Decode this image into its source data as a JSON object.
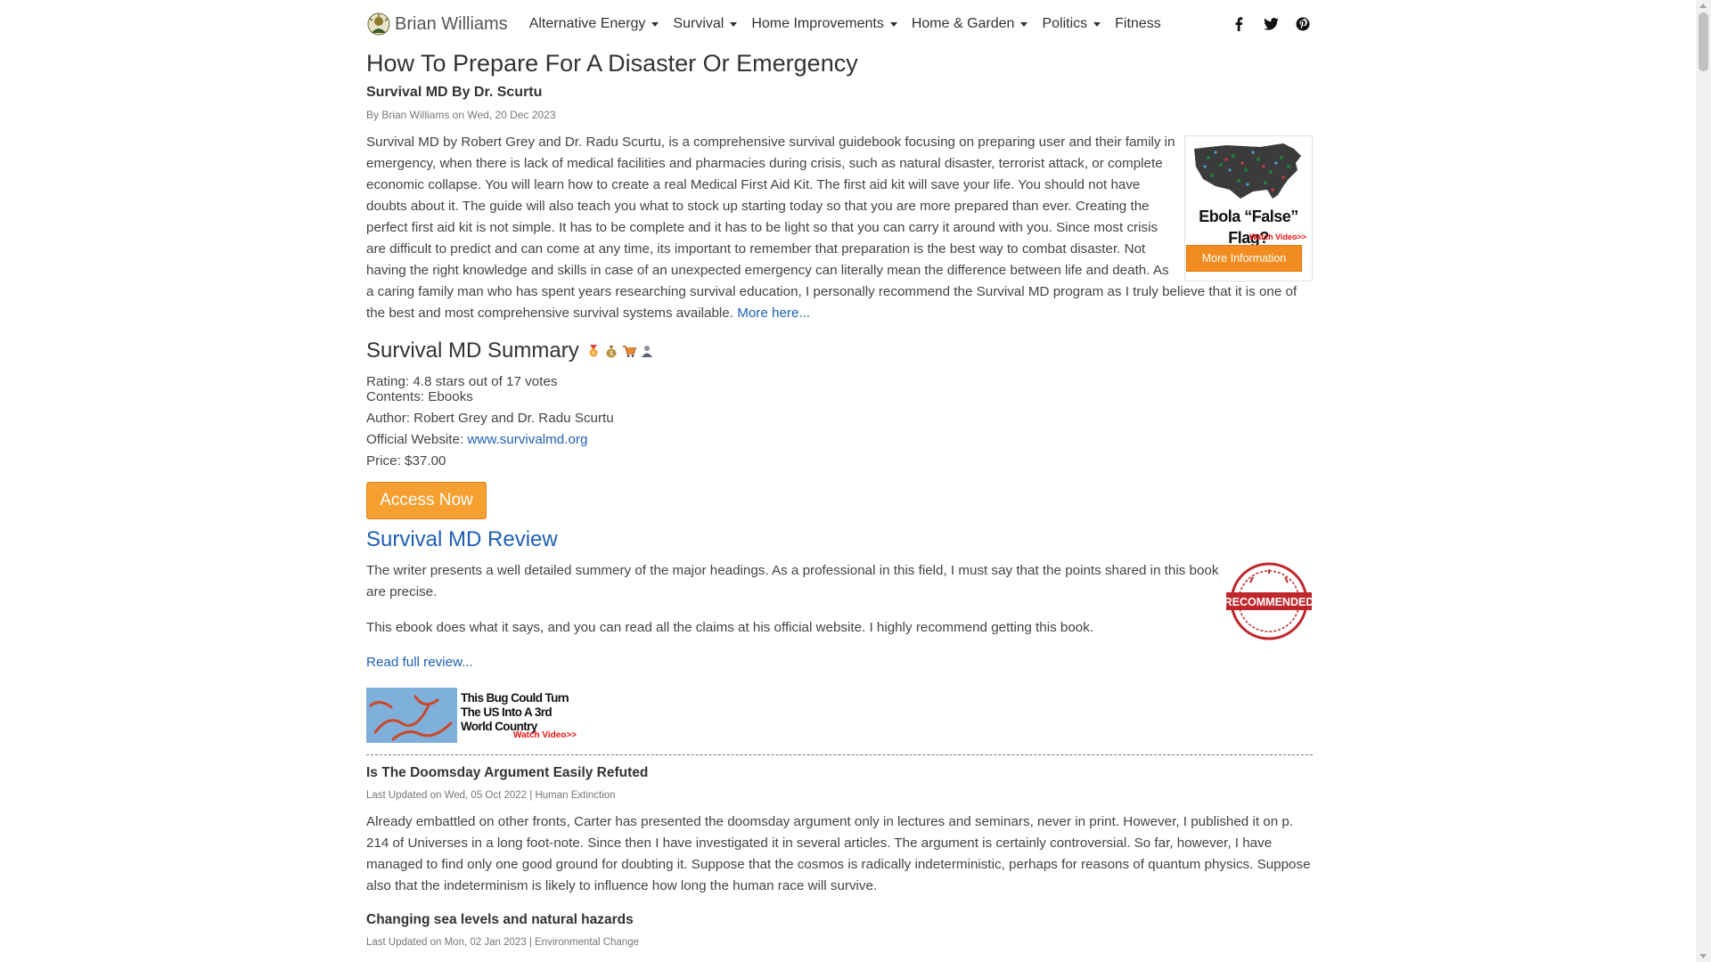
{
  "nav": {
    "brand": "Brian Williams",
    "items": [
      {
        "label": "Alternative Energy",
        "dropdown": true
      },
      {
        "label": "Survival",
        "dropdown": true
      },
      {
        "label": "Home Improvements",
        "dropdown": true
      },
      {
        "label": "Home & Garden",
        "dropdown": true
      },
      {
        "label": "Politics",
        "dropdown": true
      },
      {
        "label": "Fitness",
        "dropdown": false
      }
    ],
    "social_icons": [
      "facebook-icon",
      "twitter-icon",
      "pinterest-icon"
    ]
  },
  "article": {
    "title": "How To Prepare For A Disaster Or Emergency",
    "subtitle": "Survival MD By Dr. Scurtu",
    "byline": "By Brian Williams on Wed, 20 Dec 2023",
    "intro": "Survival MD by Robert Grey and Dr. Radu Scurtu, is a comprehensive survival guidebook focusing on preparing user and their family in emergency, when there is lack of medical facilities and pharmacies during crisis, such as natural disaster, terrorist attack, or complete economic collapse. You will learn how to create a real Medical First Aid Kit. The first aid kit will save your life. You should not have doubts about it. The guide will also teach you what to stock up starting today so that you are more prepared than ever. Creating the perfect first aid kit is not simple. It has to be complete and it has to be light so that you can carry it around with you. Since most crisis are difficult to predict and can come at any time, its important to remember that preparation is the best way to combat disaster. Not having the right knowledge and skills in case of an unexpected emergency can literally mean the difference between life and death. As a caring family man who has spent years researching survival education, I personally recommend the Survival MD program as I truly believe that it is one of the best and most comprehensive survival systems available.",
    "more_link": "More here..."
  },
  "side_ad": {
    "headline": "Ebola “False” Flag?",
    "watch": "Watch Video>>",
    "button": "More Information"
  },
  "summary": {
    "title": "Survival MD Summary",
    "rating": "Rating: 4.8 stars out of 17 votes",
    "contents": "Contents: Ebooks",
    "author": "Author: Robert Grey and Dr. Radu Scurtu",
    "website_label": "Official Website: ",
    "website_link": "www.survivalmd.org",
    "price": "Price: $37.00",
    "access_button": "Access Now"
  },
  "review": {
    "title": "Survival MD Review",
    "paragraph1": "The writer presents a well detailed summery of the major headings. As a professional in this field, I must say that the points shared in this book are precise.",
    "paragraph2": "This ebook does what it says, and you can read all the claims at his official website. I highly recommend getting this book.",
    "read_full": "Read full review...",
    "stamp_text": "RECOMMENDED"
  },
  "banner_ad": {
    "text": "This Bug Could Turn The US Into A 3rd World Country",
    "watch": "Watch Video>>"
  },
  "related": [
    {
      "title": "Is The Doomsday Argument Easily Refuted",
      "meta": "Last Updated on Wed, 05 Oct 2022 | Human Extinction",
      "body": "Already embattled on other fronts, Carter has presented the doomsday argument only in lectures and seminars, never in print. However, I published it on p. 214 of Universes in a long foot-note. Since then I have investigated it in several articles. The argument is certainly controversial. So far, however, I have managed to find only one good ground for doubting it. Suppose that the cosmos is radically indeterministic, perhaps for reasons of quantum physics. Suppose also that the indeterminism is likely to influence how long the human race will survive."
    },
    {
      "title": "Changing sea levels and natural hazards",
      "meta": "Last Updated on Mon, 02 Jan 2023 | Environmental Change"
    }
  ],
  "colors": {
    "link": "#1e5fb4",
    "access_button": "#f5a030",
    "ad_button": "#f18d20",
    "stamp": "#c0272d"
  }
}
